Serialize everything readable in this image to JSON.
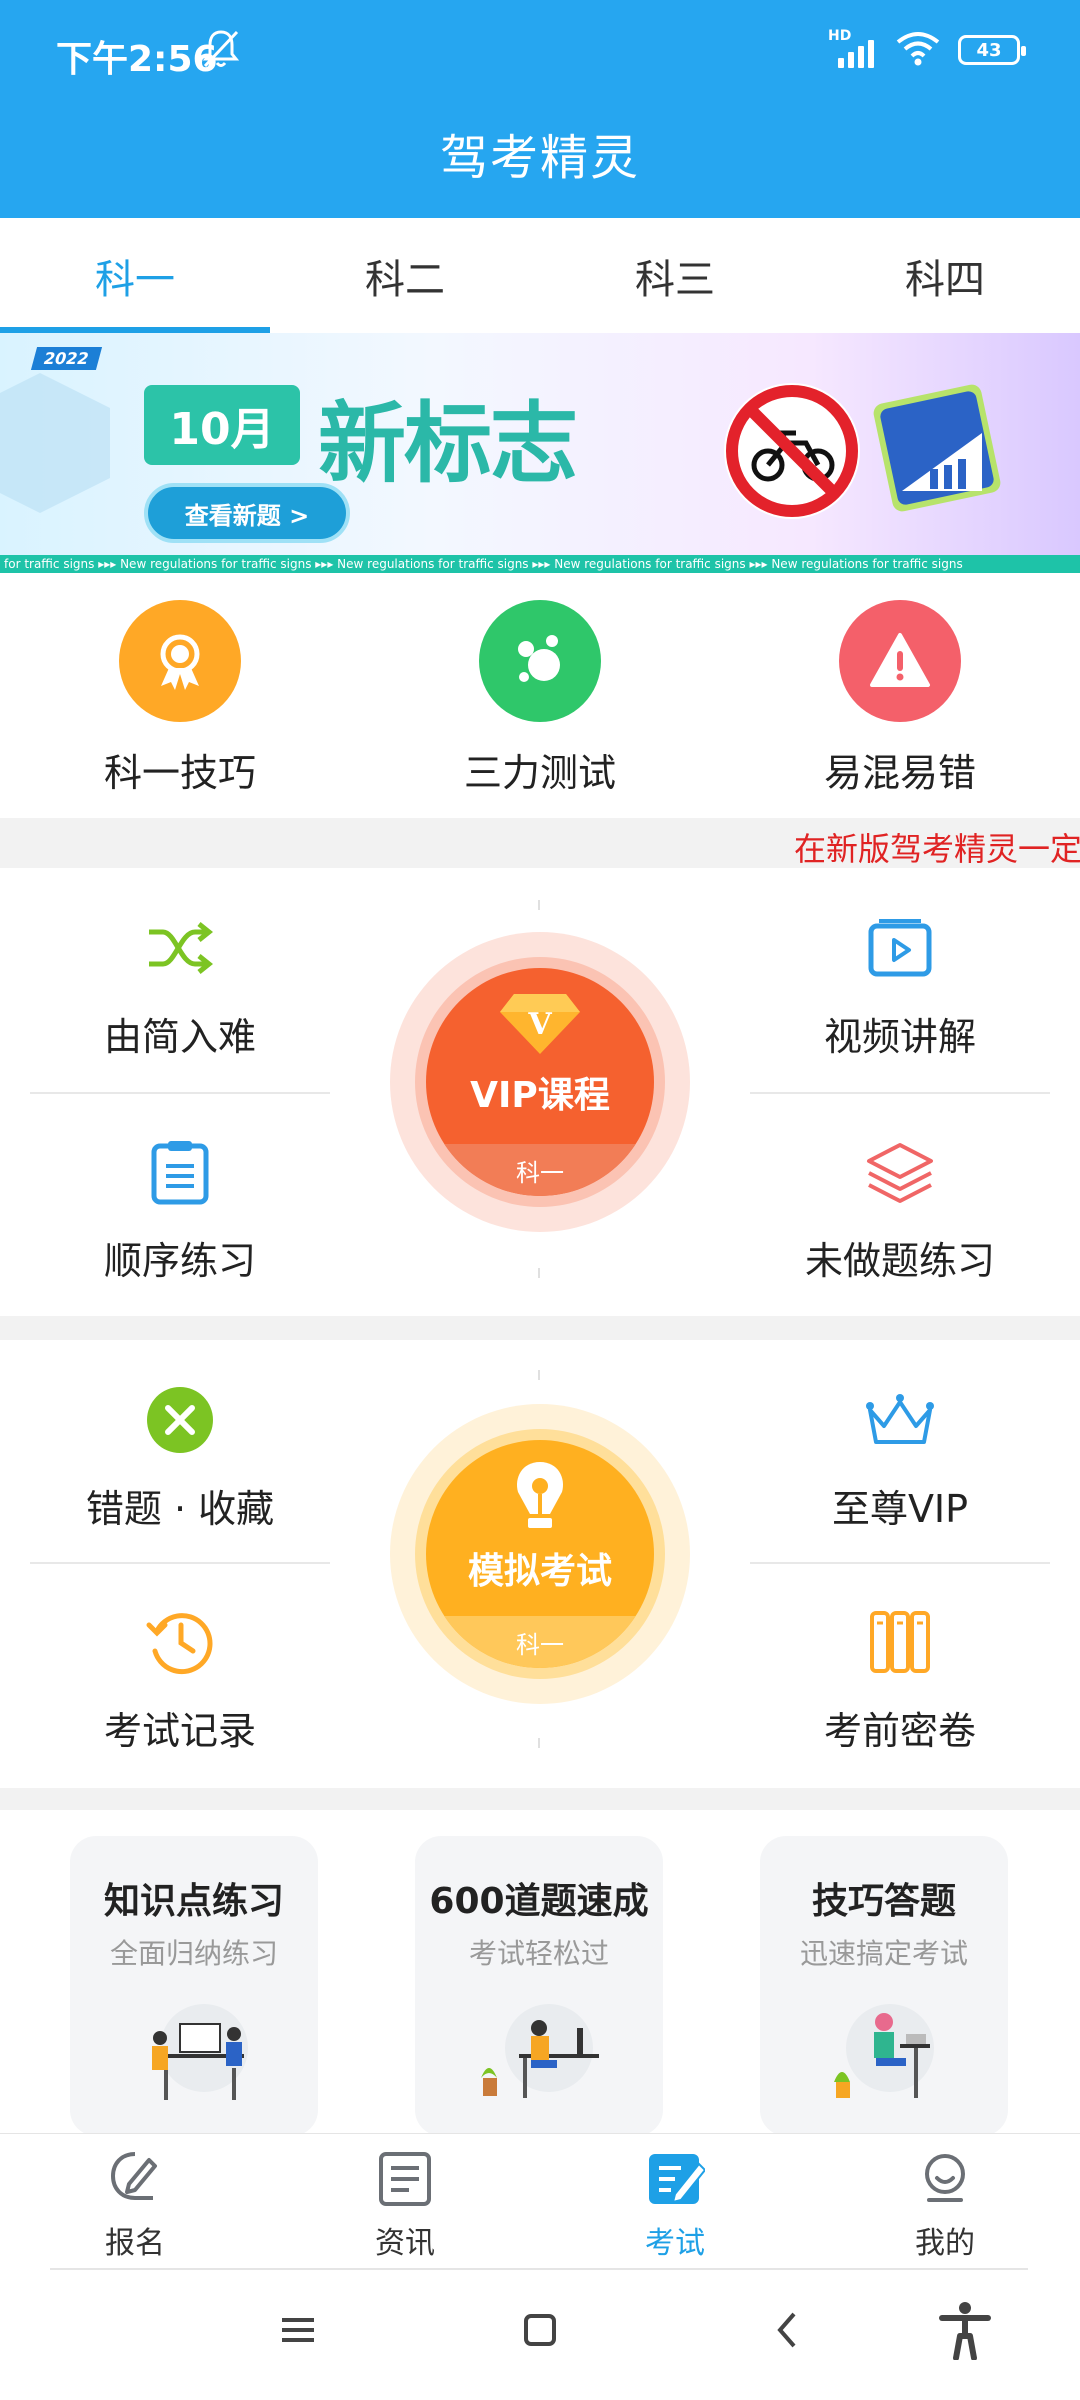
{
  "status_bar": {
    "time": "下午2:56",
    "network_badge": "HD",
    "battery": "43"
  },
  "app": {
    "title": "驾考精灵",
    "brand_color": "#26a6f0"
  },
  "subject_tabs": [
    {
      "label": "科一",
      "active": true
    },
    {
      "label": "科二",
      "active": false
    },
    {
      "label": "科三",
      "active": false
    },
    {
      "label": "科四",
      "active": false
    }
  ],
  "banner": {
    "year_tag": "2022",
    "month": "10月",
    "headline": "新标志",
    "button": "查看新题 >",
    "strip_text": "for traffic signs     ▸▸▸     New regulations for traffic signs     ▸▸▸     New regulations for traffic signs     ▸▸▸     New regulations for traffic signs     ▸▸▸     New regulations for traffic signs"
  },
  "quick_actions": [
    {
      "label": "科一技巧",
      "icon": "award-medal-icon",
      "color": "#ffa826"
    },
    {
      "label": "三力测试",
      "icon": "bubbles-icon",
      "color": "#2fc76a"
    },
    {
      "label": "易混易错",
      "icon": "warning-icon",
      "color": "#f4606a"
    }
  ],
  "marquee": "在新版驾考精灵一定",
  "practice_block_1": {
    "top_left": "由简入难",
    "bottom_left": "顺序练习",
    "top_right": "视频讲解",
    "bottom_right": "未做题练习",
    "center_label": "VIP课程",
    "center_sub": "科一"
  },
  "practice_block_2": {
    "top_left": "错题 · 收藏",
    "bottom_left": "考试记录",
    "top_right": "至尊VIP",
    "bottom_right": "考前密卷",
    "center_label": "模拟考试",
    "center_sub": "科一"
  },
  "feature_cards": [
    {
      "title": "知识点练习",
      "subtitle": "全面归纳练习"
    },
    {
      "title": "600道题速成",
      "subtitle": "考试轻松过"
    },
    {
      "title": "技巧答题",
      "subtitle": "迅速搞定考试"
    }
  ],
  "bottom_nav": [
    {
      "label": "报名",
      "icon": "pen-sign-icon",
      "active": false
    },
    {
      "label": "资讯",
      "icon": "news-icon",
      "active": false
    },
    {
      "label": "考试",
      "icon": "exam-icon",
      "active": true
    },
    {
      "label": "我的",
      "icon": "profile-icon",
      "active": false
    }
  ]
}
